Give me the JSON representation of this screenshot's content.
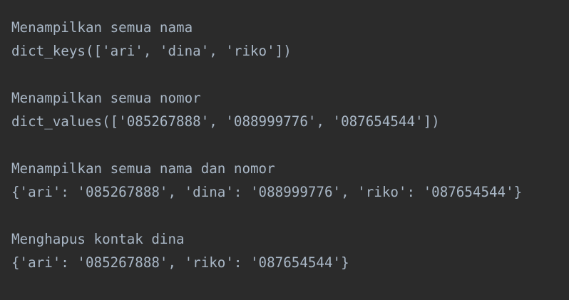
{
  "console": {
    "lines": [
      "Menampilkan semua nama",
      "dict_keys(['ari', 'dina', 'riko'])",
      "",
      "Menampilkan semua nomor",
      "dict_values(['085267888', '088999776', '087654544'])",
      "",
      "Menampilkan semua nama dan nomor",
      "{'ari': '085267888', 'dina': '088999776', 'riko': '087654544'}",
      "",
      "Menghapus kontak dina",
      "{'ari': '085267888', 'riko': '087654544'}"
    ]
  },
  "colors": {
    "background": "#2b2b2b",
    "text": "#a9b7c6"
  }
}
